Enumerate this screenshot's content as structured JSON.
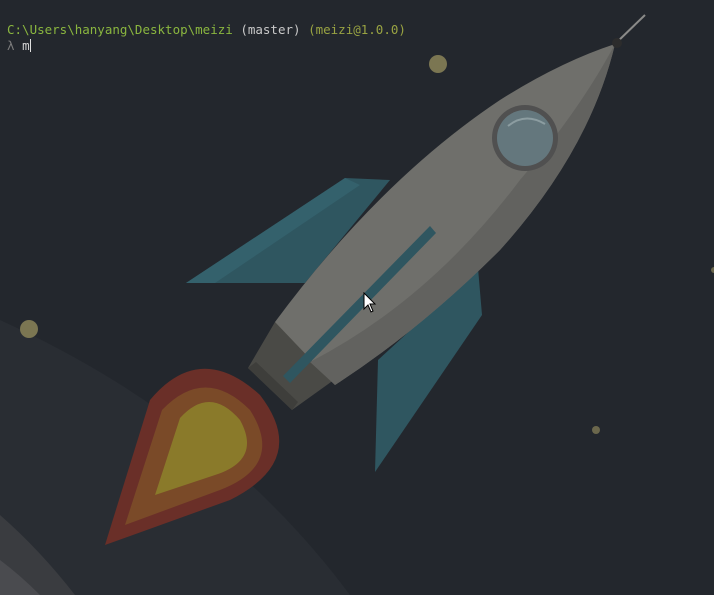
{
  "terminal": {
    "prompt": {
      "path": "C:\\Users\\hanyang\\Desktop\\meizi",
      "branch": "(master)",
      "package": "(meizi@1.0.0)"
    },
    "input": {
      "symbol": "λ",
      "text": "m"
    }
  },
  "wallpaper": {
    "subject": "rocket",
    "colors": {
      "background": "#23272d",
      "rocket_body": "#6f6f6b",
      "fins": "#2f5660",
      "flame_outer": "#6a2f28",
      "flame_inner": "#8a7a2a",
      "stars": "#7b7652"
    }
  },
  "colors": {
    "path": "#8ab63f",
    "branch": "#c9c9c9",
    "package": "#99a342",
    "lambda": "#7c7c7c"
  },
  "icons": {
    "cursor": "mouse-pointer-icon"
  }
}
